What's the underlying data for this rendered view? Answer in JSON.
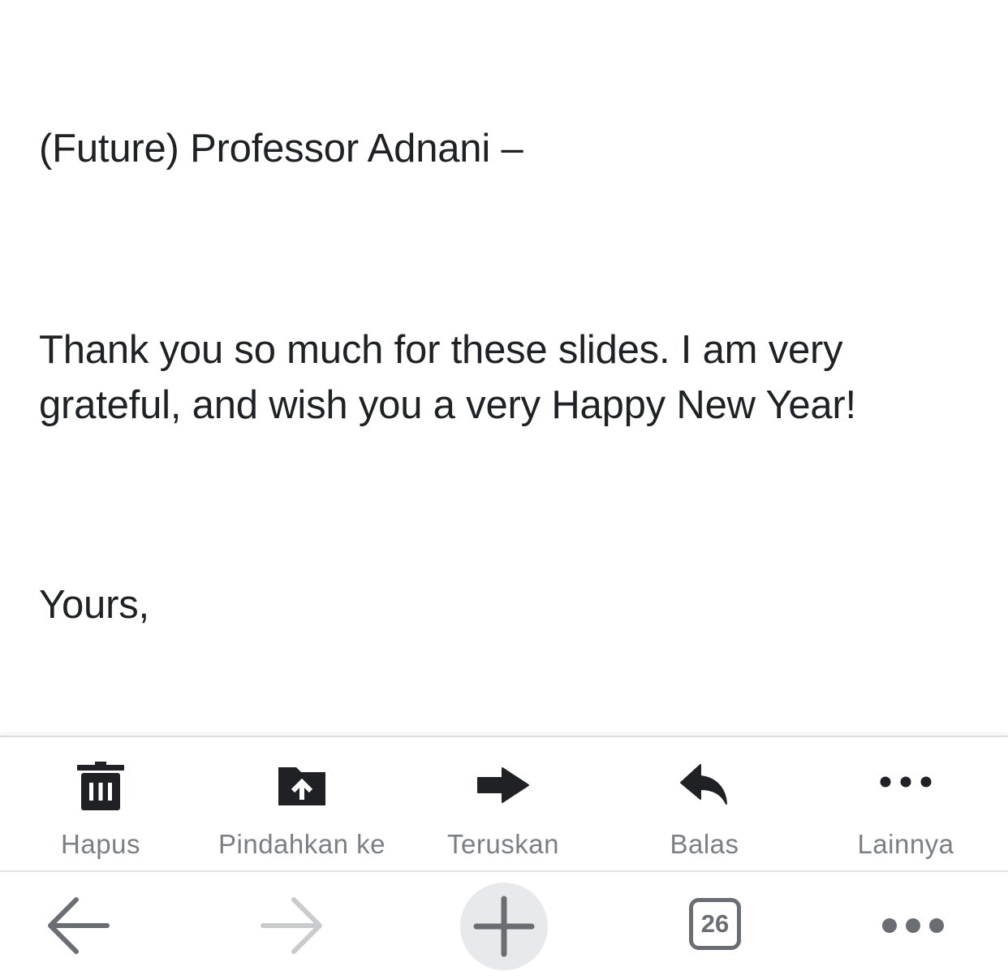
{
  "email": {
    "greeting": "(Future) Professor Adnani –",
    "body_line1": "Thank you so much for these slides. I am very",
    "body_line2": "grateful, and wish you a very Happy New Year!",
    "closing": "Yours,"
  },
  "toolbar": {
    "items": [
      {
        "label": "Hapus",
        "icon": "trash-icon"
      },
      {
        "label": "Pindahkan ke",
        "icon": "move-to-folder-icon"
      },
      {
        "label": "Teruskan",
        "icon": "forward-arrow-icon"
      },
      {
        "label": "Balas",
        "icon": "reply-icon"
      },
      {
        "label": "Lainnya",
        "icon": "more-horizontal-icon"
      }
    ]
  },
  "browser": {
    "tab_count": "26",
    "back_icon": "back-arrow-icon",
    "forward_icon": "forward-arrow-icon",
    "new_tab_icon": "plus-icon",
    "menu_icon": "more-horizontal-icon"
  },
  "colors": {
    "text": "#1f2124",
    "toolbar_icon": "#202124",
    "toolbar_label": "#7b7f84",
    "browser_icon_active": "#6a6d71",
    "browser_icon_disabled": "#c9cbcd",
    "new_tab_bg": "#e8e9eb"
  }
}
